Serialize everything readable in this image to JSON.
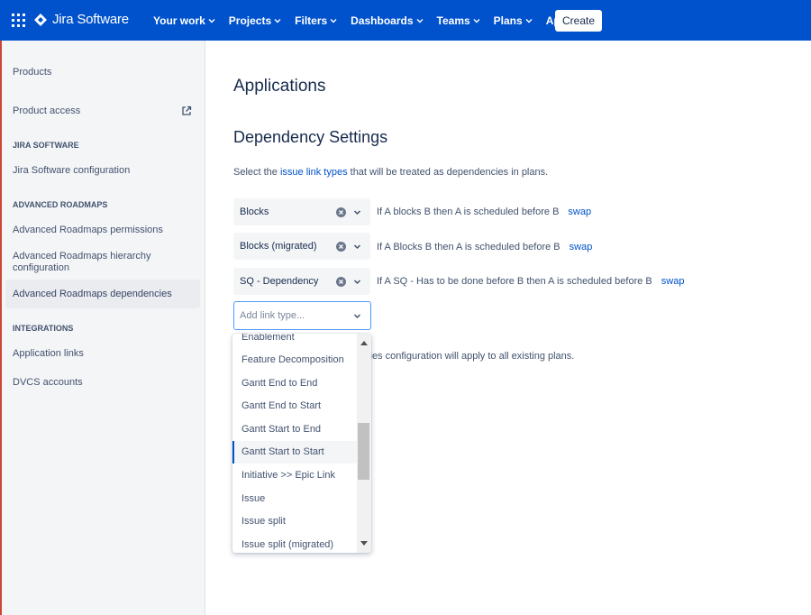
{
  "topbar": {
    "app_switcher_icon": "grid-icon",
    "logo_text": "Jira Software",
    "logo_icon": "jira-logo-icon",
    "nav": [
      {
        "label": "Your work"
      },
      {
        "label": "Projects"
      },
      {
        "label": "Filters"
      },
      {
        "label": "Dashboards"
      },
      {
        "label": "Teams"
      },
      {
        "label": "Plans"
      },
      {
        "label": "Apps"
      }
    ],
    "create_label": "Create",
    "brand_color": "#0052cc"
  },
  "sidebar": {
    "products": "Products",
    "product_access": "Product access",
    "jira_heading": "JIRA SOFTWARE",
    "jira_config": "Jira Software configuration",
    "ar_heading": "ADVANCED ROADMAPS",
    "ar_permissions": "Advanced Roadmaps permissions",
    "ar_hierarchy_line1": "Advanced Roadmaps hierarchy",
    "ar_hierarchy_line2": "configuration",
    "ar_dependencies": "Advanced Roadmaps dependencies",
    "integrations_heading": "INTEGRATIONS",
    "application_links": "Application links",
    "dvcs_accounts": "DVCS accounts"
  },
  "main": {
    "title": "Applications",
    "section_title": "Dependency Settings",
    "desc_before": "Select the ",
    "desc_link": "issue link types",
    "desc_after": " that will be treated as dependencies in plans.",
    "rows": [
      {
        "value": "Blocks",
        "rule": "If A blocks B then A is scheduled before B",
        "swap": "swap"
      },
      {
        "value": "Blocks (migrated)",
        "rule": "If A Blocks B then A is scheduled before B",
        "swap": "swap"
      },
      {
        "value": "SQ - Dependency",
        "rule": "If A SQ - Has to be done before B then A is scheduled before B",
        "swap": "swap"
      }
    ],
    "add_placeholder": "Add link type...",
    "note_partial": "cies configuration will apply to all existing plans."
  },
  "dropdown": {
    "options": [
      "Enablement",
      "Feature Decomposition",
      "Gantt End to End",
      "Gantt End to Start",
      "Gantt Start to End",
      "Gantt Start to Start",
      "Initiative >> Epic Link",
      "Issue",
      "Issue split",
      "Issue split (migrated)"
    ],
    "highlighted": "Gantt Start to Start"
  }
}
